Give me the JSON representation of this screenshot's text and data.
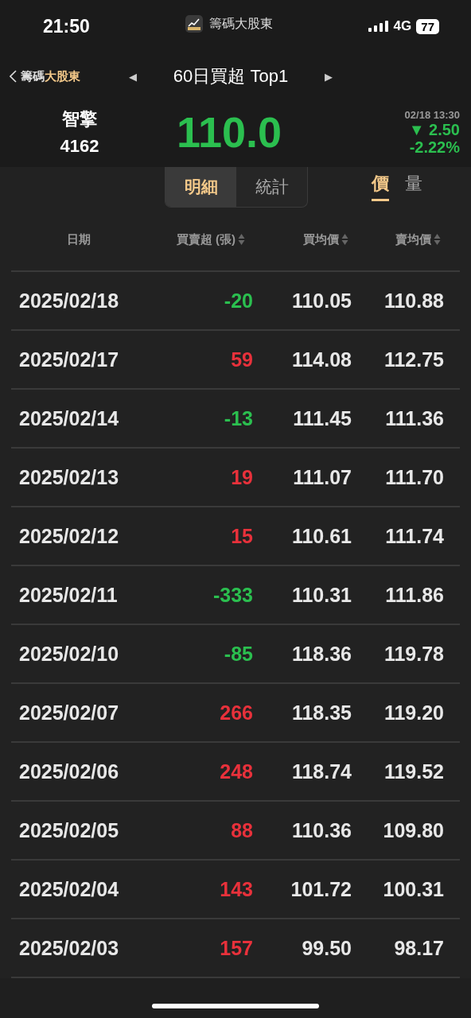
{
  "status_bar": {
    "time": "21:50",
    "app_name": "籌碼大股東",
    "network": "4G",
    "battery": "77"
  },
  "nav": {
    "back_label": "籌碼",
    "back_brand": "大股東",
    "prev": "◀",
    "title": "60日買超 Top1",
    "next": "▶"
  },
  "quote": {
    "name": "智擎",
    "code": "4162",
    "price": "110.0",
    "time": "02/18 13:30",
    "change_arrow": "▼",
    "change": "2.50",
    "change_pct": "-2.22%",
    "color": "#2bbf4f"
  },
  "view_tabs": [
    {
      "label": "明細",
      "selected": true
    },
    {
      "label": "統計",
      "selected": false
    }
  ],
  "mode_tabs": [
    {
      "label": "價",
      "selected": true
    },
    {
      "label": "量",
      "selected": false
    }
  ],
  "table": {
    "columns": [
      {
        "label": "日期",
        "sortable": false
      },
      {
        "label": "買賣超 (張)",
        "sortable": true
      },
      {
        "label": "買均價",
        "sortable": true
      },
      {
        "label": "賣均價",
        "sortable": true
      }
    ],
    "rows": [
      {
        "date": "2025/02/18",
        "net": "-20",
        "color": "#2bbf4f",
        "buy_avg": "110.05",
        "sell_avg": "110.88"
      },
      {
        "date": "2025/02/17",
        "net": "59",
        "color": "#e8313b",
        "buy_avg": "114.08",
        "sell_avg": "112.75"
      },
      {
        "date": "2025/02/14",
        "net": "-13",
        "color": "#2bbf4f",
        "buy_avg": "111.45",
        "sell_avg": "111.36"
      },
      {
        "date": "2025/02/13",
        "net": "19",
        "color": "#e8313b",
        "buy_avg": "111.07",
        "sell_avg": "111.70"
      },
      {
        "date": "2025/02/12",
        "net": "15",
        "color": "#e8313b",
        "buy_avg": "110.61",
        "sell_avg": "111.74"
      },
      {
        "date": "2025/02/11",
        "net": "-333",
        "color": "#2bbf4f",
        "buy_avg": "110.31",
        "sell_avg": "111.86"
      },
      {
        "date": "2025/02/10",
        "net": "-85",
        "color": "#2bbf4f",
        "buy_avg": "118.36",
        "sell_avg": "119.78"
      },
      {
        "date": "2025/02/07",
        "net": "266",
        "color": "#e8313b",
        "buy_avg": "118.35",
        "sell_avg": "119.20"
      },
      {
        "date": "2025/02/06",
        "net": "248",
        "color": "#e8313b",
        "buy_avg": "118.74",
        "sell_avg": "119.52"
      },
      {
        "date": "2025/02/05",
        "net": "88",
        "color": "#e8313b",
        "buy_avg": "110.36",
        "sell_avg": "109.80"
      },
      {
        "date": "2025/02/04",
        "net": "143",
        "color": "#e8313b",
        "buy_avg": "101.72",
        "sell_avg": "100.31"
      },
      {
        "date": "2025/02/03",
        "net": "157",
        "color": "#e8313b",
        "buy_avg": "99.50",
        "sell_avg": "98.17"
      }
    ]
  }
}
